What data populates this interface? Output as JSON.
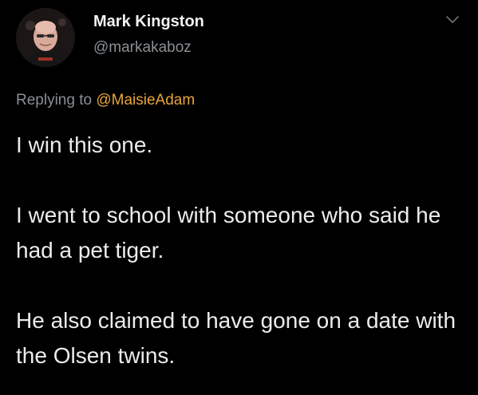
{
  "author": {
    "display_name": "Mark Kingston",
    "handle": "@markakaboz"
  },
  "reply_context": {
    "prefix": "Replying to ",
    "mention": "@MaisieAdam"
  },
  "tweet": {
    "paragraphs": [
      "I win this one.",
      "I went to school with someone who said he had a pet tiger.",
      "He also claimed to have gone on a date with the Olsen twins."
    ]
  },
  "icons": {
    "menu": "chevron-down-icon",
    "avatar": "profile-photo"
  },
  "colors": {
    "background": "#000000",
    "text": "#ececec",
    "secondary": "#8a8f94",
    "mention": "#e8a63a"
  }
}
